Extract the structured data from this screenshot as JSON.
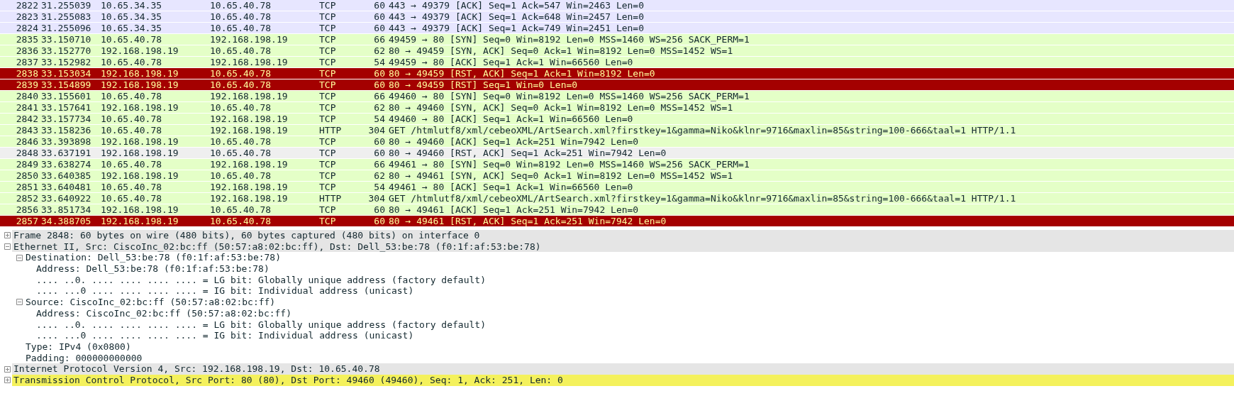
{
  "packet_list": {
    "rows": [
      {
        "no": "2822",
        "time": "31.255039",
        "source": "10.65.34.35",
        "destination": "10.65.40.78",
        "protocol": "TCP",
        "length": "60",
        "info": "443 → 49379 [ACK] Seq=1 Ack=547 Win=2463 Len=0",
        "color": "#e7e6ff",
        "selected": false
      },
      {
        "no": "2823",
        "time": "31.255083",
        "source": "10.65.34.35",
        "destination": "10.65.40.78",
        "protocol": "TCP",
        "length": "60",
        "info": "443 → 49379 [ACK] Seq=1 Ack=648 Win=2457 Len=0",
        "color": "#e7e6ff",
        "selected": false
      },
      {
        "no": "2824",
        "time": "31.255096",
        "source": "10.65.34.35",
        "destination": "10.65.40.78",
        "protocol": "TCP",
        "length": "60",
        "info": "443 → 49379 [ACK] Seq=1 Ack=749 Win=2451 Len=0",
        "color": "#e7e6ff",
        "selected": false
      },
      {
        "no": "2835",
        "time": "33.150710",
        "source": "10.65.40.78",
        "destination": "192.168.198.19",
        "protocol": "TCP",
        "length": "66",
        "info": "49459 → 80 [SYN] Seq=0 Win=8192 Len=0 MSS=1460 WS=256 SACK_PERM=1",
        "color": "#e4ffc7",
        "selected": false
      },
      {
        "no": "2836",
        "time": "33.152770",
        "source": "192.168.198.19",
        "destination": "10.65.40.78",
        "protocol": "TCP",
        "length": "62",
        "info": "80 → 49459 [SYN, ACK] Seq=0 Ack=1 Win=8192 Len=0 MSS=1452 WS=1",
        "color": "#e4ffc7",
        "selected": false
      },
      {
        "no": "2837",
        "time": "33.152982",
        "source": "10.65.40.78",
        "destination": "192.168.198.19",
        "protocol": "TCP",
        "length": "54",
        "info": "49459 → 80 [ACK] Seq=1 Ack=1 Win=66560 Len=0",
        "color": "#e4ffc7",
        "selected": false
      },
      {
        "no": "2838",
        "time": "33.153034",
        "source": "192.168.198.19",
        "destination": "10.65.40.78",
        "protocol": "TCP",
        "length": "60",
        "info": "80 → 49459 [RST, ACK] Seq=1 Ack=1 Win=8192 Len=0",
        "color": "#a40000",
        "selected": false
      },
      {
        "no": "2839",
        "time": "33.154899",
        "source": "192.168.198.19",
        "destination": "10.65.40.78",
        "protocol": "TCP",
        "length": "60",
        "info": "80 → 49459 [RST] Seq=1 Win=0 Len=0",
        "color": "#a40000",
        "selected": false
      },
      {
        "no": "2840",
        "time": "33.155601",
        "source": "10.65.40.78",
        "destination": "192.168.198.19",
        "protocol": "TCP",
        "length": "66",
        "info": "49460 → 80 [SYN] Seq=0 Win=8192 Len=0 MSS=1460 WS=256 SACK_PERM=1",
        "color": "#e4ffc7",
        "selected": false
      },
      {
        "no": "2841",
        "time": "33.157641",
        "source": "192.168.198.19",
        "destination": "10.65.40.78",
        "protocol": "TCP",
        "length": "62",
        "info": "80 → 49460 [SYN, ACK] Seq=0 Ack=1 Win=8192 Len=0 MSS=1452 WS=1",
        "color": "#e4ffc7",
        "selected": false
      },
      {
        "no": "2842",
        "time": "33.157734",
        "source": "10.65.40.78",
        "destination": "192.168.198.19",
        "protocol": "TCP",
        "length": "54",
        "info": "49460 → 80 [ACK] Seq=1 Ack=1 Win=66560 Len=0",
        "color": "#e4ffc7",
        "selected": false
      },
      {
        "no": "2843",
        "time": "33.158236",
        "source": "10.65.40.78",
        "destination": "192.168.198.19",
        "protocol": "HTTP",
        "length": "304",
        "info": "GET /htmlutf8/xml/cebeoXML/ArtSearch.xml?firstkey=1&gamma=Niko&klnr=9716&maxlin=85&string=100-666&taal=1 HTTP/1.1",
        "color": "#e4ffc7",
        "selected": false
      },
      {
        "no": "2846",
        "time": "33.393898",
        "source": "192.168.198.19",
        "destination": "10.65.40.78",
        "protocol": "TCP",
        "length": "60",
        "info": "80 → 49460 [ACK] Seq=1 Ack=251 Win=7942 Len=0",
        "color": "#e4ffc7",
        "selected": false
      },
      {
        "no": "2848",
        "time": "33.637191",
        "source": "192.168.198.19",
        "destination": "10.65.40.78",
        "protocol": "TCP",
        "length": "60",
        "info": "80 → 49460 [RST, ACK] Seq=1 Ack=251 Win=7942 Len=0",
        "selected": true
      },
      {
        "no": "2849",
        "time": "33.638274",
        "source": "10.65.40.78",
        "destination": "192.168.198.19",
        "protocol": "TCP",
        "length": "66",
        "info": "49461 → 80 [SYN] Seq=0 Win=8192 Len=0 MSS=1460 WS=256 SACK_PERM=1",
        "color": "#e4ffc7",
        "selected": false
      },
      {
        "no": "2850",
        "time": "33.640385",
        "source": "192.168.198.19",
        "destination": "10.65.40.78",
        "protocol": "TCP",
        "length": "62",
        "info": "80 → 49461 [SYN, ACK] Seq=0 Ack=1 Win=8192 Len=0 MSS=1452 WS=1",
        "color": "#e4ffc7",
        "selected": false
      },
      {
        "no": "2851",
        "time": "33.640481",
        "source": "10.65.40.78",
        "destination": "192.168.198.19",
        "protocol": "TCP",
        "length": "54",
        "info": "49461 → 80 [ACK] Seq=1 Ack=1 Win=66560 Len=0",
        "color": "#e4ffc7",
        "selected": false
      },
      {
        "no": "2852",
        "time": "33.640922",
        "source": "10.65.40.78",
        "destination": "192.168.198.19",
        "protocol": "HTTP",
        "length": "304",
        "info": "GET /htmlutf8/xml/cebeoXML/ArtSearch.xml?firstkey=1&gamma=Niko&klnr=9716&maxlin=85&string=100-666&taal=1 HTTP/1.1",
        "color": "#e4ffc7",
        "selected": false
      },
      {
        "no": "2856",
        "time": "33.851734",
        "source": "192.168.198.19",
        "destination": "10.65.40.78",
        "protocol": "TCP",
        "length": "60",
        "info": "80 → 49461 [ACK] Seq=1 Ack=251 Win=7942 Len=0",
        "color": "#e4ffc7",
        "selected": false
      },
      {
        "no": "2857",
        "time": "34.388705",
        "source": "192.168.198.19",
        "destination": "10.65.40.78",
        "protocol": "TCP",
        "length": "60",
        "info": "80 → 49461 [RST, ACK] Seq=1 Ack=251 Win=7942 Len=0",
        "color": "#a40000",
        "selected": false
      }
    ]
  },
  "packet_details": {
    "items": [
      {
        "text": "Frame 2848: 60 bytes on wire (480 bits), 60 bytes captured (480 bits) on interface 0",
        "kind": "node",
        "expanded": false,
        "warning": false
      },
      {
        "text": "Ethernet II, Src: CiscoInc_02:bc:ff (50:57:a8:02:bc:ff), Dst: Dell_53:be:78 (f0:1f:af:53:be:78)",
        "kind": "node",
        "expanded": true,
        "warning": false,
        "children": [
          {
            "text": "Destination: Dell_53:be:78 (f0:1f:af:53:be:78)",
            "kind": "node",
            "expanded": true,
            "children": [
              {
                "text": "Address: Dell_53:be:78 (f0:1f:af:53:be:78)",
                "kind": "leaf"
              },
              {
                "text": ".... ..0. .... .... .... .... = LG bit: Globally unique address (factory default)",
                "kind": "leaf"
              },
              {
                "text": ".... ...0 .... .... .... .... = IG bit: Individual address (unicast)",
                "kind": "leaf"
              }
            ]
          },
          {
            "text": "Source: CiscoInc_02:bc:ff (50:57:a8:02:bc:ff)",
            "kind": "node",
            "expanded": true,
            "children": [
              {
                "text": "Address: CiscoInc_02:bc:ff (50:57:a8:02:bc:ff)",
                "kind": "leaf"
              },
              {
                "text": ".... ..0. .... .... .... .... = LG bit: Globally unique address (factory default)",
                "kind": "leaf"
              },
              {
                "text": ".... ...0 .... .... .... .... = IG bit: Individual address (unicast)",
                "kind": "leaf"
              }
            ]
          },
          {
            "text": "Type: IPv4 (0x0800)",
            "kind": "leaf"
          },
          {
            "text": "Padding: 000000000000",
            "kind": "leaf"
          }
        ]
      },
      {
        "text": "Internet Protocol Version 4, Src: 192.168.198.19, Dst: 10.65.40.78",
        "kind": "node",
        "expanded": false,
        "warning": false
      },
      {
        "text": "Transmission Control Protocol, Src Port: 80 (80), Dst Port: 49460 (49460), Seq: 1, Ack: 251, Len: 0",
        "kind": "node",
        "expanded": false,
        "warning": true
      }
    ]
  }
}
